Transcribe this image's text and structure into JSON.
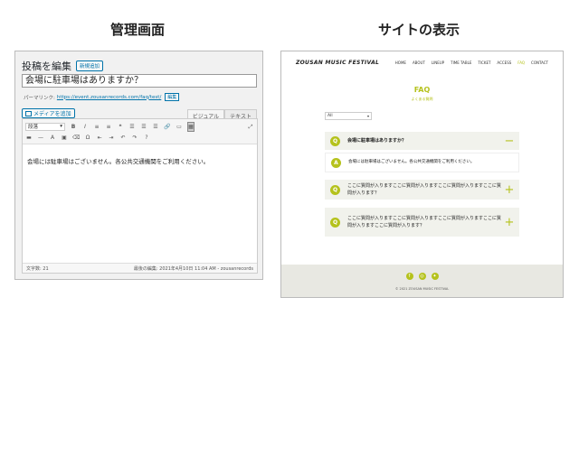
{
  "titles": {
    "admin": "管理画面",
    "site": "サイトの表示"
  },
  "admin": {
    "heading": "投稿を編集",
    "new_button": "新規追加",
    "post_title": "会場に駐車場はありますか？",
    "permalink_label": "パーマリンク:",
    "permalink_url": "https://event.zousanrecords.com/faq/test/",
    "edit_button": "編集",
    "media_button": "メディアを追加",
    "tab_visual": "ビジュアル",
    "tab_text": "テキスト",
    "format_select": "段落",
    "content": "会場には駐車場はございません。各公共交通機関をご利用ください。",
    "word_count": "文字数: 21",
    "last_edited": "最後の編集: 2021年4月10日 11:04 AM - zousanrecords"
  },
  "site": {
    "logo": "ZOUSAN MUSIC FESTIVAL",
    "menu": [
      "HOME",
      "ABOUT",
      "LINEUP",
      "TIME TABLE",
      "TICKET",
      "ACCESS",
      "FAQ",
      "CONTACT"
    ],
    "active_menu": "FAQ",
    "faq_heading": "FAQ",
    "faq_subheading": "よくある質問",
    "filter_value": "All",
    "q1": "会場に駐車場はありますか？",
    "a1": "会場には駐車場はございません。各公共交通機関をご利用ください。",
    "q2": "ここに質問が入りますここに質問が入りますここに質問が入りますここに質問が入ります？",
    "q3": "ここに質問が入りますここに質問が入りますここに質問が入りますここに質問が入りますここに質問が入ります？",
    "q_mark": "Q",
    "a_mark": "A",
    "minus": "−",
    "plus": "+",
    "copyright": "© 2021 ZOUSAN MUSIC FESTIVAL"
  },
  "colors": {
    "accent": "#b5c21c",
    "wp_blue": "#0073aa"
  }
}
